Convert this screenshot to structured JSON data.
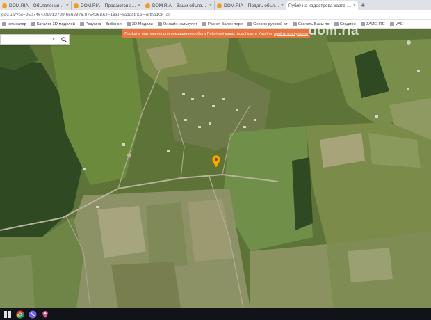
{
  "browser": {
    "tabs": [
      {
        "label": "DOM.RIA – Объявления о прод",
        "favicon": "domria-icon",
        "active": false
      },
      {
        "label": "DOM.RIA – Продаются земельн",
        "favicon": "domria-icon",
        "active": false
      },
      {
        "label": "DOM.RIA – Ваши объявления д",
        "favicon": "domria-icon",
        "active": false
      },
      {
        "label": "DOM.RIA – Подать объявление",
        "favicon": "domria-icon",
        "active": false
      },
      {
        "label": "Публічна кадастрова карта Укр",
        "favicon": "map-icon",
        "active": true
      }
    ],
    "new_tab_label": "+",
    "close_label": "×",
    "address": "gov.ua/?cc=2507464.09912729,6562876.8754268&z=16&l=kadastr&bl=ortho10k_all",
    "bookmarks": [
      {
        "label": "кртинатор",
        "icon": "bookmark-icon"
      },
      {
        "label": "Каталог 3D моделей",
        "icon": "bookmark-icon"
      },
      {
        "label": "Розумна – Вибіл сп",
        "icon": "bookmark-icon"
      },
      {
        "label": "3D Модели",
        "icon": "bookmark-icon"
      },
      {
        "label": "Онлайн калькулят",
        "icon": "bookmark-icon"
      },
      {
        "label": "Расчет балок пере",
        "icon": "bookmark-icon"
      },
      {
        "label": "Сервис русской ст",
        "icon": "bookmark-icon"
      },
      {
        "label": "Скачать Базы по",
        "icon": "bookmark-icon"
      },
      {
        "label": "Стадион",
        "icon": "bookmark-icon"
      },
      {
        "label": "ЗАЙЕНТЕ",
        "icon": "bookmark-icon"
      },
      {
        "label": "VAE",
        "icon": "bookmark-icon"
      }
    ]
  },
  "map": {
    "search": {
      "value": "",
      "placeholder": "",
      "clear_label": "×"
    },
    "banner": {
      "text": "Пройдіть опитування для покращення роботи Публічної кадастрової карти України",
      "link_label": "пройти опитування"
    },
    "watermark_text": "dom.ria",
    "marker": "location-pin-icon",
    "colors": {
      "banner": "#e8763f",
      "marker": "#f2a900"
    }
  },
  "taskbar": {
    "items": [
      "windows-start-icon",
      "chrome-icon",
      "viber-icon",
      "maps-icon"
    ]
  }
}
